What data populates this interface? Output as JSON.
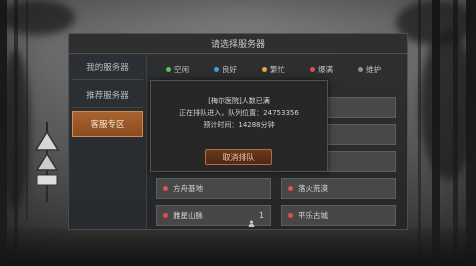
{
  "dialog": {
    "title": "请选择服务器"
  },
  "sidebar": {
    "items": [
      {
        "label": "我的服务器",
        "selected": false
      },
      {
        "label": "推荐服务器",
        "selected": false
      },
      {
        "label": "客服专区",
        "selected": true
      }
    ]
  },
  "legend": [
    {
      "label": "空闲",
      "color": "#57c24f"
    },
    {
      "label": "良好",
      "color": "#3f9de0"
    },
    {
      "label": "繁忙",
      "color": "#e8a53a"
    },
    {
      "label": "爆满",
      "color": "#e05050"
    },
    {
      "label": "维护",
      "color": "#8e8e8e"
    }
  ],
  "servers": [
    {
      "name": "方舟基地",
      "status_color": "#e05050"
    },
    {
      "name": "落火荒漠",
      "status_color": "#e05050"
    },
    {
      "name": "雅星山脉",
      "status_color": "#e05050",
      "character_icon": "person-icon",
      "character_count": "1"
    },
    {
      "name": "平乐古城",
      "status_color": "#e05050"
    }
  ],
  "queue_popup": {
    "server_tag": "[梅尔医院]",
    "message": "人数已满",
    "position_label": "正在排队进入，队列位置：",
    "position": "24753356",
    "eta_label": "预计时间：",
    "eta": "14288",
    "eta_unit": "分钟",
    "cancel_label": "取消排队"
  }
}
